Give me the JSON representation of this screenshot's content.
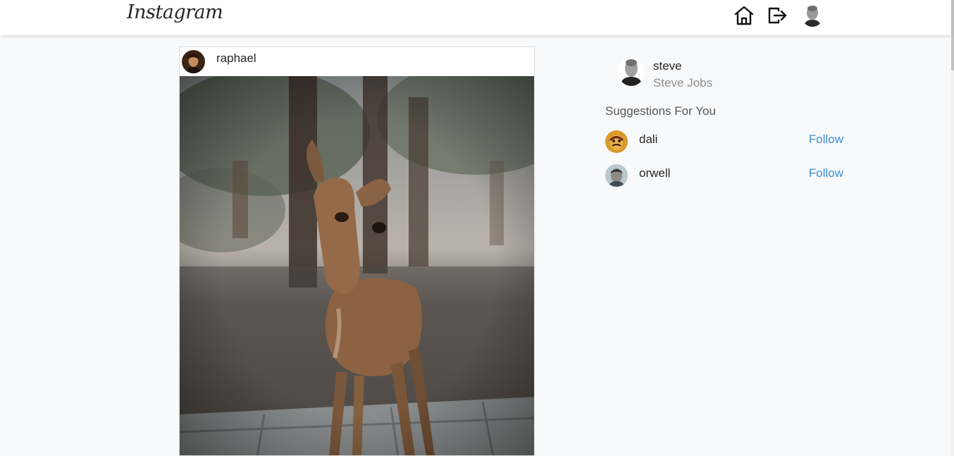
{
  "header": {
    "logo_text": "Instagram",
    "home_icon": "home-icon",
    "logout_icon": "logout-icon",
    "avatar_icon": "user-avatar"
  },
  "post": {
    "username": "raphael",
    "image": "deer-photo"
  },
  "profile": {
    "username": "steve",
    "full_name": "Steve Jobs"
  },
  "suggestions": {
    "title": "Suggestions For You",
    "users": [
      {
        "username": "dali",
        "action": "Follow"
      },
      {
        "username": "orwell",
        "action": "Follow"
      }
    ]
  },
  "colors": {
    "background": "#f8f9fb",
    "link": "#3b8fd4",
    "muted": "#8e8e8e"
  }
}
